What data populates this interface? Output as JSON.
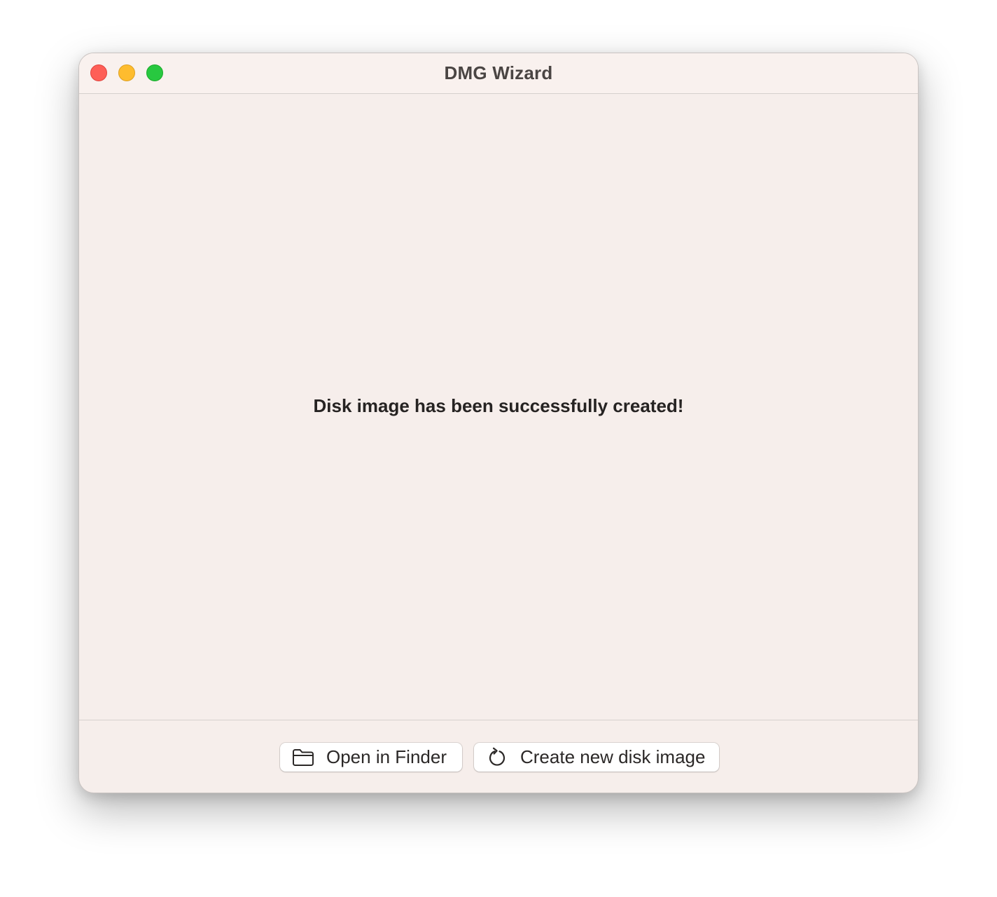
{
  "window": {
    "title": "DMG Wizard"
  },
  "traffic_lights": {
    "close_color": "#fe5f57",
    "minimize_color": "#febc2e",
    "zoom_color": "#28c840"
  },
  "content": {
    "message": "Disk image has been successfully created!"
  },
  "footer": {
    "buttons": [
      {
        "label": "Open in Finder",
        "icon": "folder-icon"
      },
      {
        "label": "Create new disk image",
        "icon": "refresh-icon"
      }
    ]
  }
}
